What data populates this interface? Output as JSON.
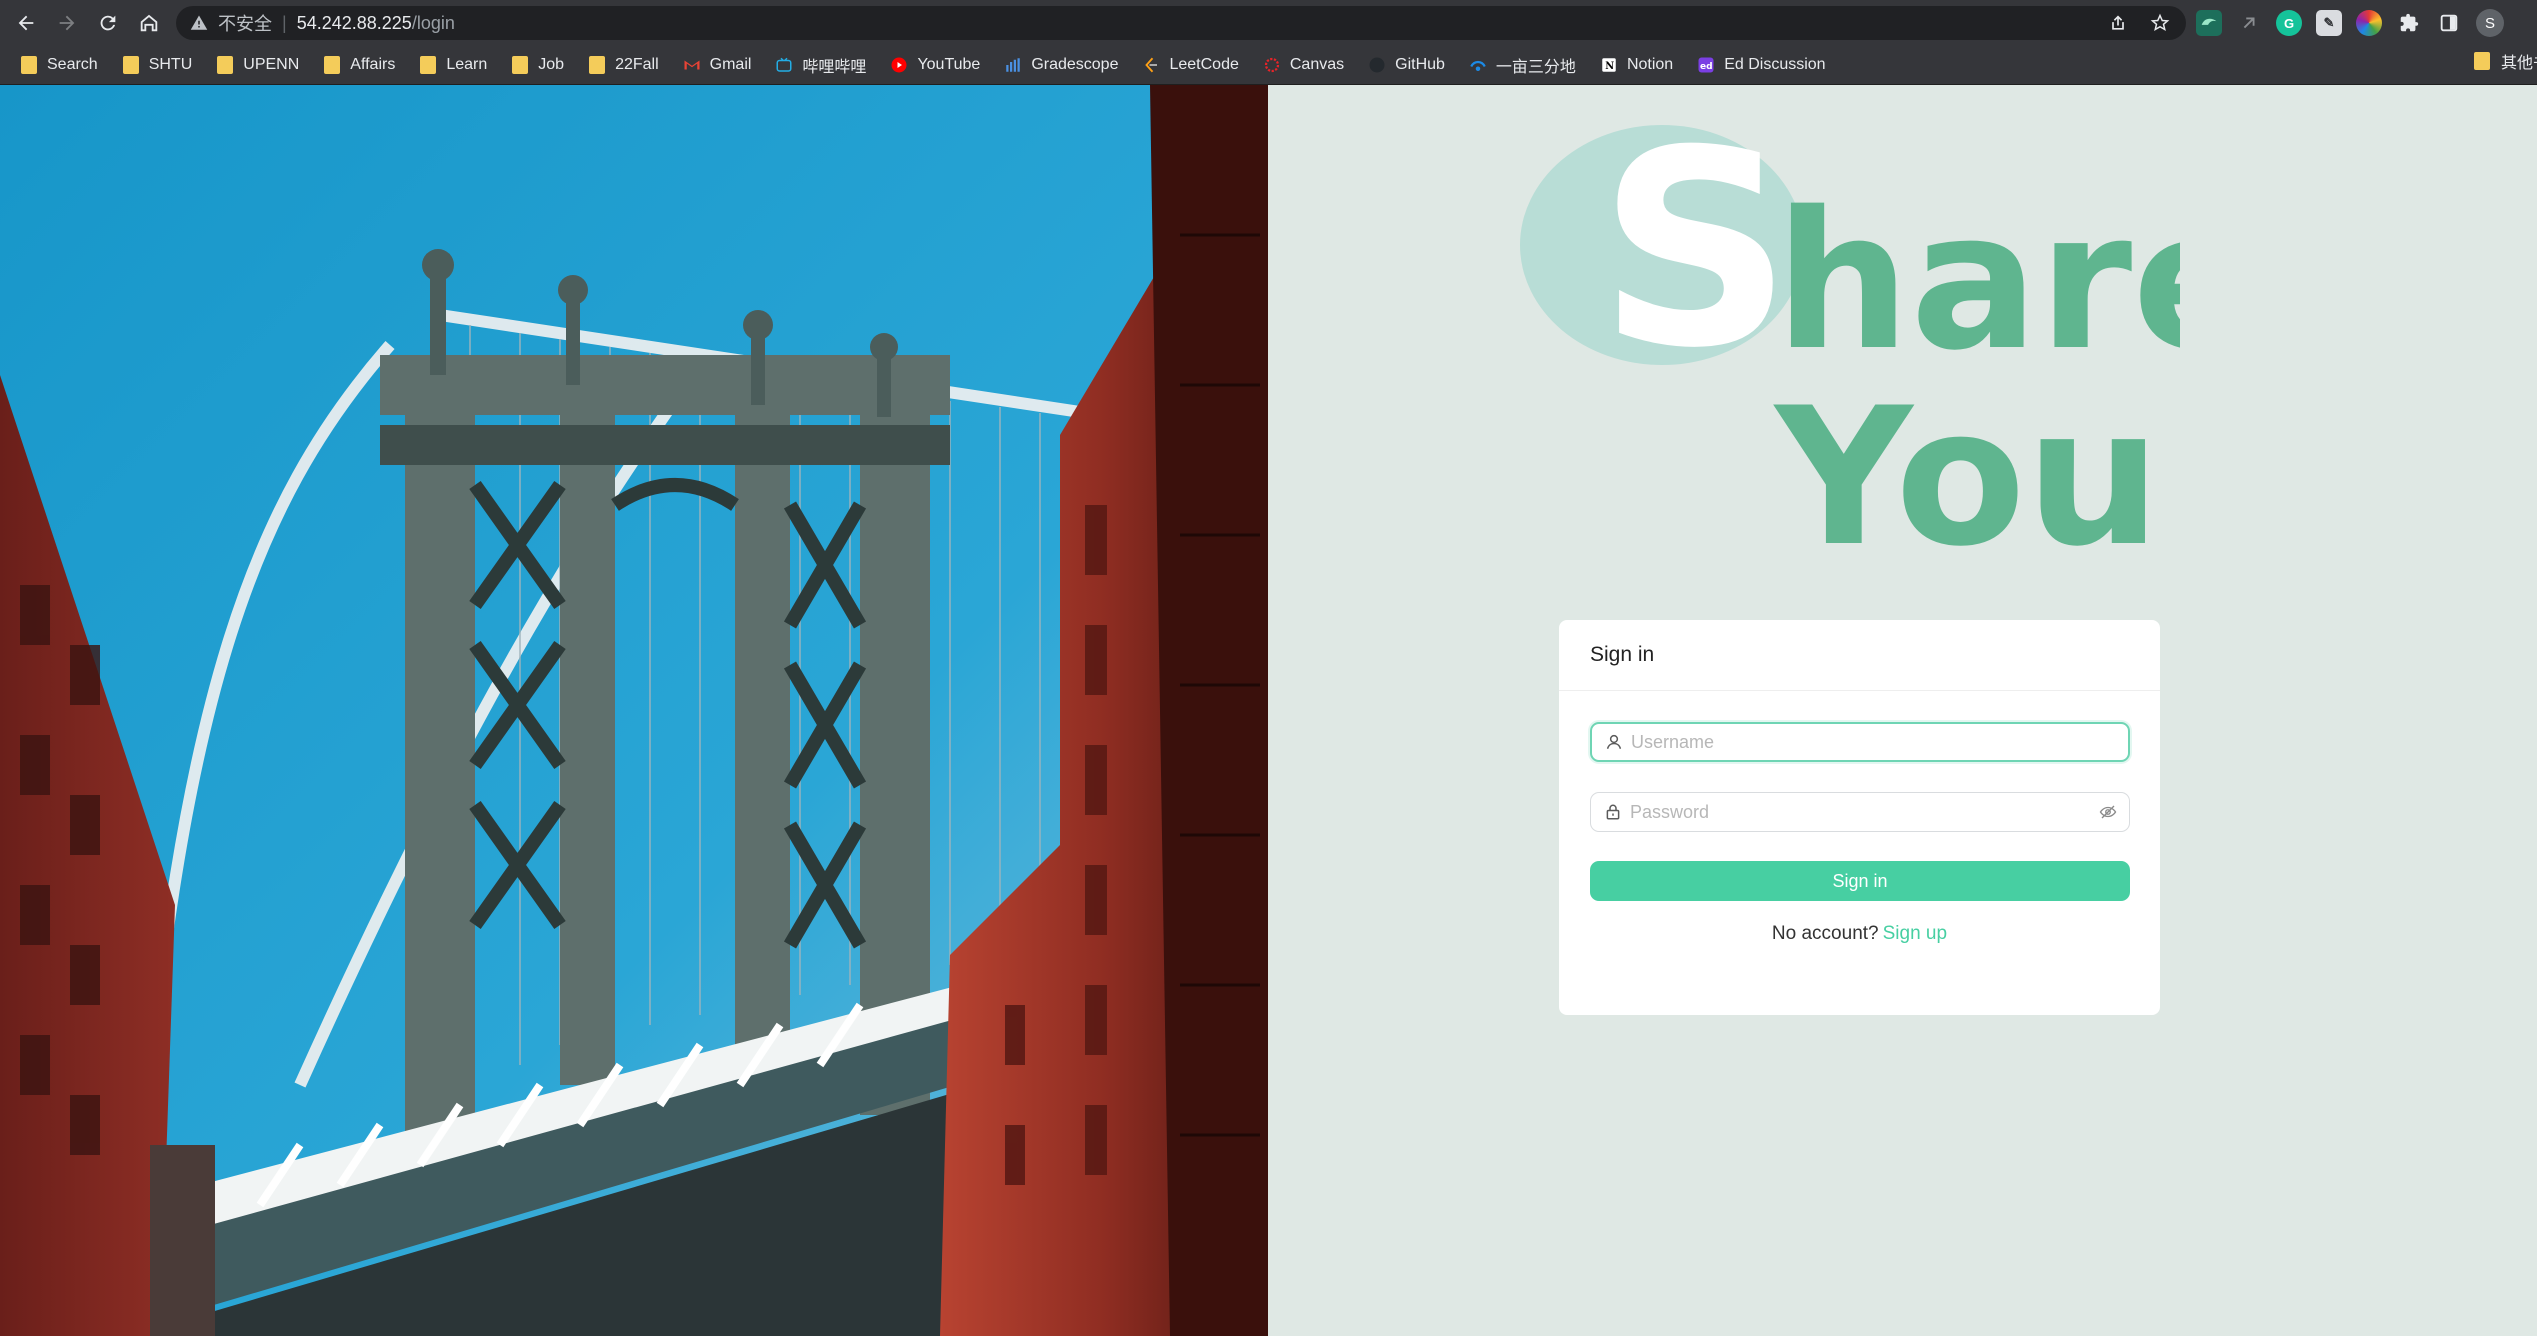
{
  "browser": {
    "url_insecure_label": "不安全",
    "url_host": "54.242.88.225",
    "url_path": "/login",
    "avatar_initial": "S"
  },
  "bookmarks": [
    {
      "label": "Search",
      "icon": "folder-icon"
    },
    {
      "label": "SHTU",
      "icon": "folder-icon"
    },
    {
      "label": "UPENN",
      "icon": "folder-icon"
    },
    {
      "label": "Affairs",
      "icon": "folder-icon"
    },
    {
      "label": "Learn",
      "icon": "folder-icon"
    },
    {
      "label": "Job",
      "icon": "folder-icon"
    },
    {
      "label": "22Fall",
      "icon": "folder-icon"
    },
    {
      "label": "Gmail",
      "icon": "gmail-icon"
    },
    {
      "label": "哔哩哔哩",
      "icon": "bilibili-icon"
    },
    {
      "label": "YouTube",
      "icon": "youtube-icon"
    },
    {
      "label": "Gradescope",
      "icon": "gradescope-icon"
    },
    {
      "label": "LeetCode",
      "icon": "leetcode-icon"
    },
    {
      "label": "Canvas",
      "icon": "canvas-icon"
    },
    {
      "label": "GitHub",
      "icon": "github-icon"
    },
    {
      "label": "一亩三分地",
      "icon": "1point3acres-icon"
    },
    {
      "label": "Notion",
      "icon": "notion-icon"
    },
    {
      "label": "Ed Discussion",
      "icon": "ed-icon"
    }
  ],
  "bookmarks_overflow_label": "其他书签",
  "logo": {
    "line1_initial": "S",
    "line1_rest": "hare",
    "line2": "You",
    "colors": {
      "circle": "#b8ddd6",
      "text": "#5fb58f",
      "initial": "#ffffff"
    }
  },
  "signin": {
    "title": "Sign in",
    "username_placeholder": "Username",
    "password_placeholder": "Password",
    "button_label": "Sign in",
    "no_account_text": "No account?",
    "signup_link": "Sign up"
  },
  "colors": {
    "accent": "#47cfa2",
    "page_bg": "#dfe8e4"
  }
}
